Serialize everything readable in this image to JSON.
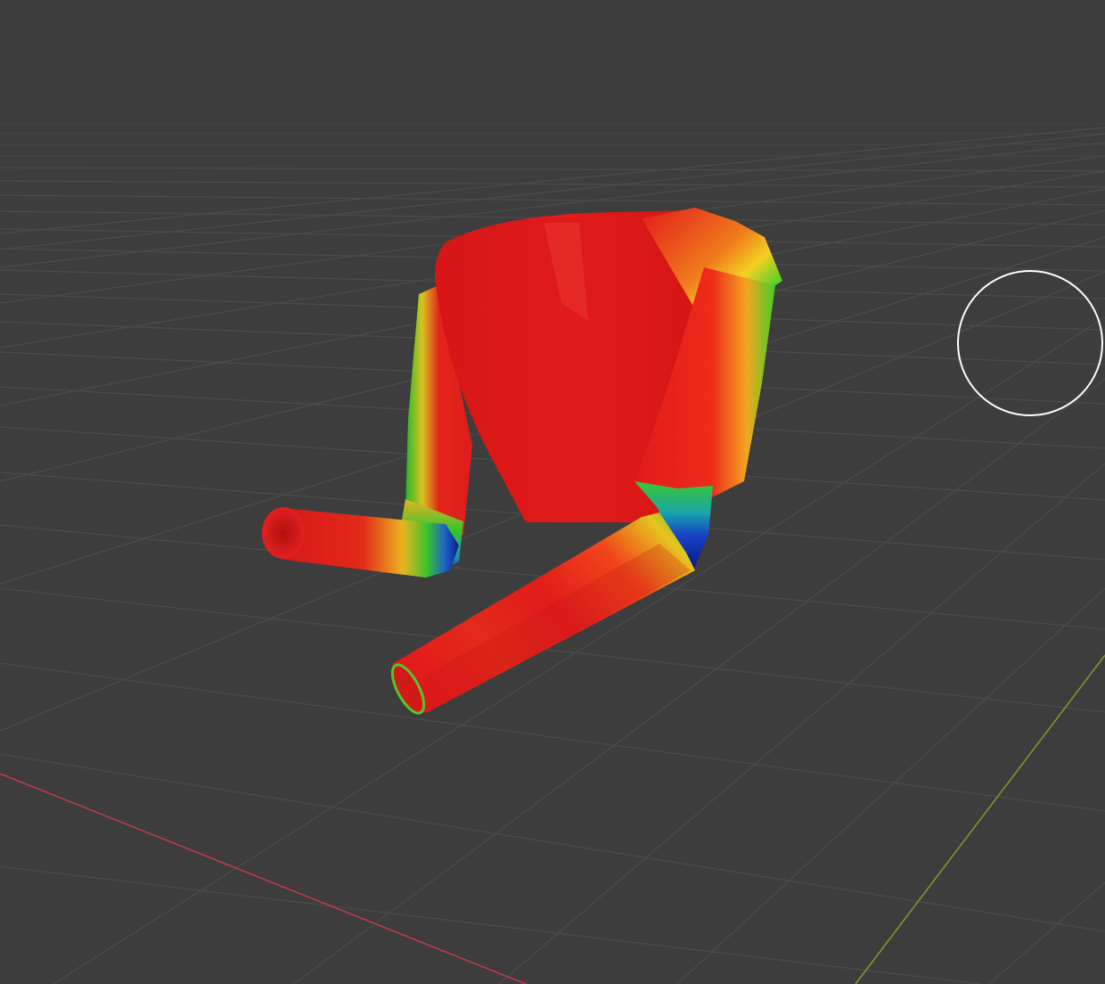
{
  "viewport": {
    "background_color": "#3d3d3d",
    "grid_line_color": "#4b4b4b",
    "x_axis_color": "#c0394b",
    "y_axis_color": "#7a9a2a"
  },
  "object": {
    "name": "shirt-mesh",
    "display_mode": "weight-paint",
    "weight_colors": [
      "#e11d1d",
      "#f0c020",
      "#2ecc2e",
      "#1a5fd0",
      "#0b1a8f"
    ]
  },
  "brush_cursor": {
    "shape": "circle-icon",
    "color": "#ffffff"
  }
}
